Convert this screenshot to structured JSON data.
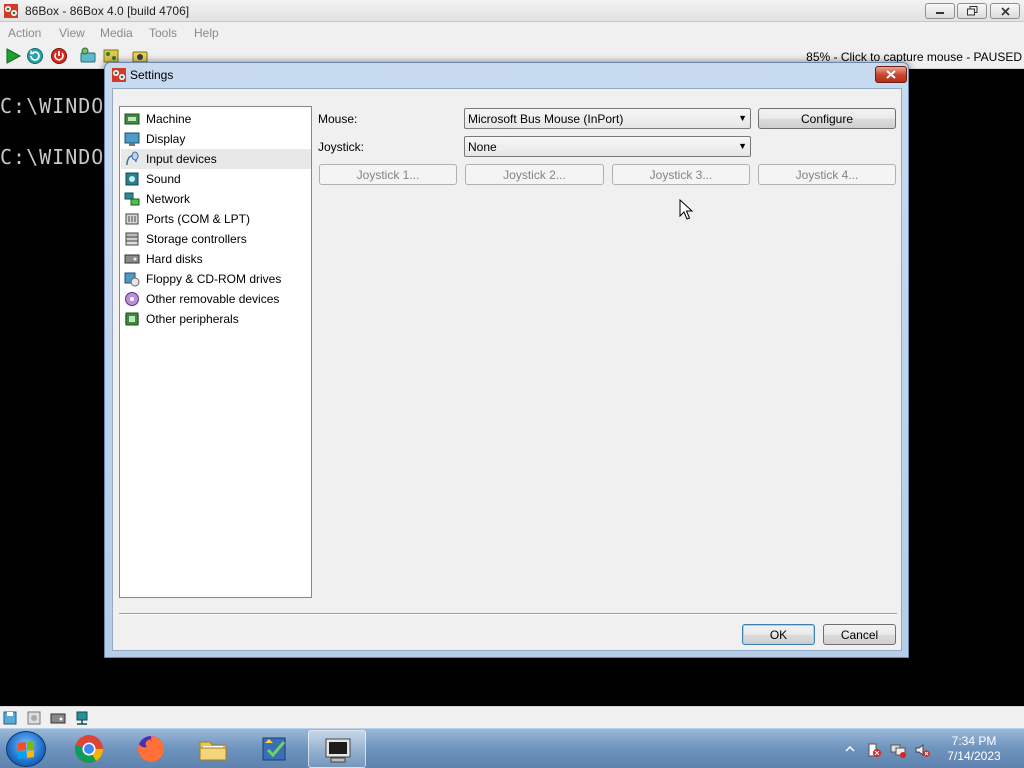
{
  "main_window": {
    "title": "86Box - 86Box 4.0 [build 4706]",
    "menu": [
      "Action",
      "View",
      "Media",
      "Tools",
      "Help"
    ],
    "status_text": "85% - Click to capture mouse - PAUSED",
    "screen_lines": [
      "C:\\WINDOU",
      "C:\\WINDOU"
    ]
  },
  "settings": {
    "title": "Settings",
    "nav_items": [
      {
        "label": "Machine",
        "icon": "machine-icon"
      },
      {
        "label": "Display",
        "icon": "display-icon"
      },
      {
        "label": "Input devices",
        "icon": "input-devices-icon",
        "selected": true
      },
      {
        "label": "Sound",
        "icon": "sound-icon"
      },
      {
        "label": "Network",
        "icon": "network-icon"
      },
      {
        "label": "Ports (COM & LPT)",
        "icon": "ports-icon"
      },
      {
        "label": "Storage controllers",
        "icon": "storage-controllers-icon"
      },
      {
        "label": "Hard disks",
        "icon": "hard-disk-icon"
      },
      {
        "label": "Floppy & CD-ROM drives",
        "icon": "floppy-cdrom-icon"
      },
      {
        "label": "Other removable devices",
        "icon": "removable-devices-icon"
      },
      {
        "label": "Other peripherals",
        "icon": "peripherals-icon"
      }
    ],
    "mouse_label": "Mouse:",
    "mouse_value": "Microsoft Bus Mouse (InPort)",
    "configure_label": "Configure",
    "joystick_label": "Joystick:",
    "joystick_value": "None",
    "joystick_buttons": [
      "Joystick 1...",
      "Joystick 2...",
      "Joystick 3...",
      "Joystick 4..."
    ],
    "ok_label": "OK",
    "cancel_label": "Cancel"
  },
  "taskbar": {
    "time": "7:34 PM",
    "date": "7/14/2023"
  },
  "colors": {
    "dialog_frame": "#b6cde8",
    "taskbar": "#6e93bd",
    "close_button": "#c7432b",
    "selection": "#e8e8e8"
  }
}
